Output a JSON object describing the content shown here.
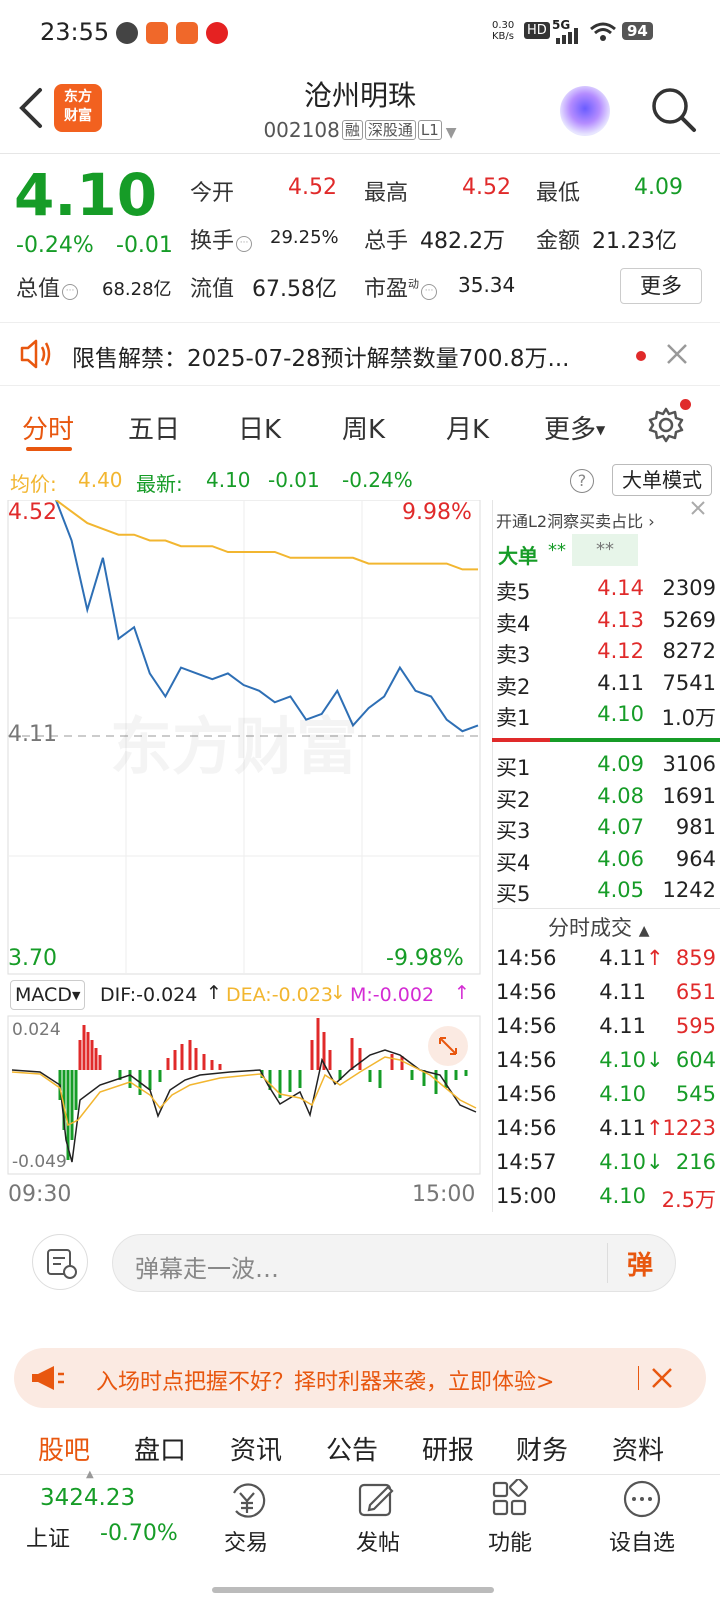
{
  "status_bar": {
    "time": "23:55",
    "net_speed": "0.30\nKB/s",
    "hd": "HD",
    "signal": "5G",
    "battery": "94"
  },
  "header": {
    "title": "沧州明珠",
    "code": "002108",
    "tags": [
      "融",
      "深股通",
      "L1"
    ],
    "logo_line1": "东方",
    "logo_line2": "财富"
  },
  "quote": {
    "price": "4.10",
    "change_pct": "-0.24%",
    "change": "-0.01",
    "open_label": "今开",
    "open": "4.52",
    "high_label": "最高",
    "high": "4.52",
    "low_label": "最低",
    "low": "4.09",
    "turnover_label": "换手",
    "turnover": "29.25%",
    "volume_label": "总手",
    "volume": "482.2万",
    "amount_label": "金额",
    "amount": "21.23亿",
    "mktcap_label": "总值",
    "mktcap": "68.28亿",
    "float_label": "流值",
    "float": "67.58亿",
    "pe_label": "市盈",
    "pe_sup": "动",
    "pe": "35.34",
    "more_label": "更多"
  },
  "notice": {
    "text": "限售解禁：2025-07-28预计解禁数量700.8万..."
  },
  "tabs": [
    "分时",
    "五日",
    "日K",
    "周K",
    "月K",
    "更多"
  ],
  "avg_row": {
    "avg_label": "均价:",
    "avg": "4.40",
    "latest_label": "最新:",
    "latest": "4.10",
    "chg": "-0.01",
    "pct": "-0.24%",
    "mode_btn": "大单模式"
  },
  "chart": {
    "price_high": "4.52",
    "price_high_pct": "9.98%",
    "price_low": "3.70",
    "price_low_pct": "-9.98%",
    "mid_price": "4.11",
    "watermark": "东方财富",
    "macd_label": "MACD",
    "dif": "DIF:-0.024",
    "dea": "DEA:-0.023",
    "m": "M:-0.002",
    "macd_max": "0.024",
    "macd_min": "-0.049",
    "time_start": "09:30",
    "time_end": "15:00"
  },
  "chart_data": {
    "type": "line",
    "title": "",
    "ylim": [
      3.7,
      4.52
    ],
    "series": [
      {
        "values": [
          4.52,
          4.45,
          4.33,
          4.42,
          4.28,
          4.3,
          4.22,
          4.18,
          4.23,
          4.22,
          4.21,
          4.22,
          4.2,
          4.19,
          4.17,
          4.18,
          4.14,
          4.15,
          4.19,
          4.13,
          4.16,
          4.18,
          4.23,
          4.19,
          4.18,
          4.14,
          4.12,
          4.13
        ]
      },
      {
        "values": [
          4.52,
          4.5,
          4.48,
          4.47,
          4.46,
          4.46,
          4.45,
          4.45,
          4.44,
          4.44,
          4.44,
          4.43,
          4.43,
          4.43,
          4.43,
          4.42,
          4.42,
          4.42,
          4.42,
          4.42,
          4.41,
          4.41,
          4.41,
          4.41,
          4.41,
          4.41,
          4.4,
          4.4
        ]
      }
    ]
  },
  "right_panel": {
    "l2_text": "开通L2洞察买卖占比",
    "big_order_label": "大单",
    "big_order_val": "**",
    "big_order_val2": "**",
    "asks": [
      {
        "label": "卖5",
        "price": "4.14",
        "vol": "2309",
        "color": "red"
      },
      {
        "label": "卖4",
        "price": "4.13",
        "vol": "5269",
        "color": "red"
      },
      {
        "label": "卖3",
        "price": "4.12",
        "vol": "8272",
        "color": "red"
      },
      {
        "label": "卖2",
        "price": "4.11",
        "vol": "7541",
        "color": "black"
      },
      {
        "label": "卖1",
        "price": "4.10",
        "vol": "1.0万",
        "color": "green"
      }
    ],
    "bids": [
      {
        "label": "买1",
        "price": "4.09",
        "vol": "3106",
        "color": "green"
      },
      {
        "label": "买2",
        "price": "4.08",
        "vol": "1691",
        "color": "green"
      },
      {
        "label": "买3",
        "price": "4.07",
        "vol": "981",
        "color": "green"
      },
      {
        "label": "买4",
        "price": "4.06",
        "vol": "964",
        "color": "green"
      },
      {
        "label": "买5",
        "price": "4.05",
        "vol": "1242",
        "color": "green"
      }
    ],
    "trades_title": "分时成交",
    "trades": [
      {
        "time": "14:56",
        "price": "4.11",
        "arrow": "↑",
        "vol": "859",
        "pcolor": "black",
        "vcolor": "red"
      },
      {
        "time": "14:56",
        "price": "4.11",
        "arrow": "",
        "vol": "651",
        "pcolor": "black",
        "vcolor": "red"
      },
      {
        "time": "14:56",
        "price": "4.11",
        "arrow": "",
        "vol": "595",
        "pcolor": "black",
        "vcolor": "red"
      },
      {
        "time": "14:56",
        "price": "4.10",
        "arrow": "↓",
        "vol": "604",
        "pcolor": "green",
        "vcolor": "green"
      },
      {
        "time": "14:56",
        "price": "4.10",
        "arrow": "",
        "vol": "545",
        "pcolor": "green",
        "vcolor": "green"
      },
      {
        "time": "14:56",
        "price": "4.11",
        "arrow": "↑",
        "vol": "1223",
        "pcolor": "black",
        "vcolor": "red"
      },
      {
        "time": "14:57",
        "price": "4.10",
        "arrow": "↓",
        "vol": "216",
        "pcolor": "green",
        "vcolor": "green"
      },
      {
        "time": "15:00",
        "price": "4.10",
        "arrow": "",
        "vol": "2.5万",
        "pcolor": "green",
        "vcolor": "red"
      }
    ]
  },
  "danmu": {
    "placeholder": "弹幕走一波…",
    "btn": "弹"
  },
  "ad": {
    "text": "入场时点把握不好？择时利器来袭，立即体验>"
  },
  "sub_tabs": [
    "股吧",
    "盘口",
    "资讯",
    "公告",
    "研报",
    "财务",
    "资料"
  ],
  "bottom_nav": {
    "index_value": "3424.23",
    "index_name": "上证",
    "index_pct": "-0.70%",
    "items": [
      "交易",
      "发帖",
      "功能",
      "设自选"
    ]
  },
  "colors": {
    "up": "#e02a2a",
    "down": "#169c27",
    "accent": "#e8570f",
    "price_line": "#2e6fb5",
    "avg_line": "#f2b630"
  }
}
